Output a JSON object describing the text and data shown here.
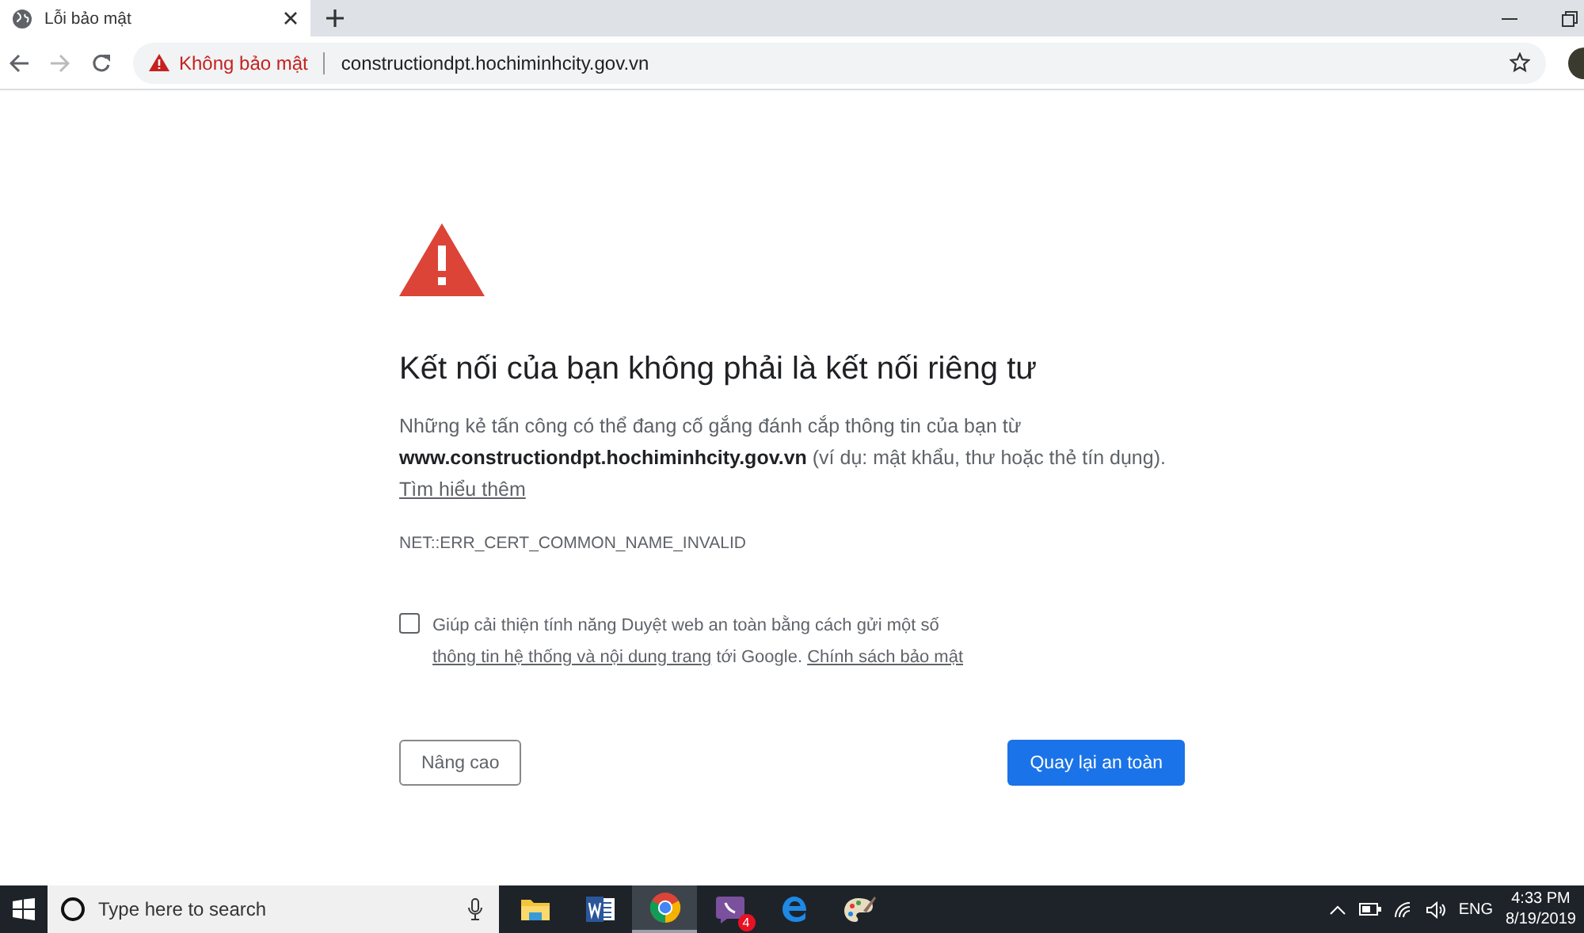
{
  "tab": {
    "title": "Lỗi bảo mật"
  },
  "address_bar": {
    "security_label": "Không bảo mật",
    "url": "constructiondpt.hochiminhcity.gov.vn"
  },
  "page": {
    "heading": "Kết nối của bạn không phải là kết nối riêng tư",
    "paragraph": "Những kẻ tấn công có thể đang cố gắng đánh cắp thông tin của bạn từ **www.constructiondpt.hochiminhcity.gov.vn** (ví dụ: mật khẩu, thư hoặc thẻ tín dụng).",
    "learn_more": "Tìm hiểu thêm",
    "error_code": "NET::ERR_CERT_COMMON_NAME_INVALID",
    "report": {
      "checked": false,
      "text_before": "Giúp cải thiện tính năng Duyệt web an toàn bằng cách gửi một số",
      "link": "thông tin hệ thống và nội dung trang",
      "text_after": "tới Google.",
      "policy_link": "Chính sách bảo mật"
    },
    "advanced_button": "Nâng cao",
    "back_button": "Quay lại an toàn"
  },
  "taskbar": {
    "search_placeholder": "Type here to search",
    "apps": [
      {
        "kind": "folder",
        "selected": false
      },
      {
        "kind": "word",
        "selected": false
      },
      {
        "kind": "chrome",
        "selected": true
      },
      {
        "kind": "viber",
        "selected": false,
        "badge": "4"
      },
      {
        "kind": "edge",
        "selected": false
      },
      {
        "kind": "paint",
        "selected": false
      }
    ],
    "language": "ENG",
    "time": "4:33 PM",
    "date": "8/19/2019"
  }
}
